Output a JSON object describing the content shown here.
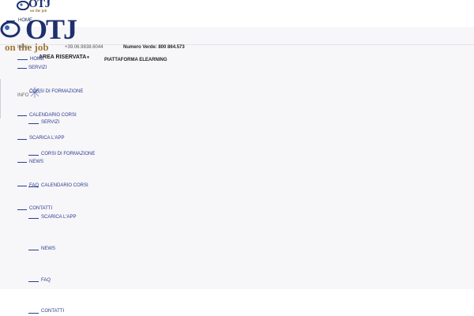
{
  "logo": {
    "mark": "OTJ",
    "registered": "®",
    "tagline": "on the job"
  },
  "top_nav": {
    "home": "HOME"
  },
  "contact": {
    "left_text": "Inizio",
    "phone": "+39.06.9838.6044",
    "toll_free": "Numero Verde: 800 864.573"
  },
  "header_links": {
    "reserved_area": "AREA RISERVATA",
    "reserved_area_chevron": "chevron-down-icon",
    "elearning": "PIATTAFORMA ELEARNING"
  },
  "menu_primary": [
    "HOME",
    "SERVIZI",
    "CORSI DI FORMAZIONE",
    "CALENDARIO CORSI",
    "SCARICA L'APP",
    "NEWS",
    "FAQ",
    "CONTATTI"
  ],
  "menu_secondary": [
    "SERVIZI",
    "CORSI DI FORMAZIONE",
    "CALENDARIO CORSI",
    "SCARICA L'APP",
    "NEWS",
    "FAQ",
    "CONTATTI"
  ],
  "info_label": "INFO",
  "icons": {
    "logo_mark": "globe-o-icon",
    "sparkle": "sparkle-icon"
  },
  "colors": {
    "brand_blue": "#1e2f6e",
    "brand_gold": "#a07a3a",
    "link_blue": "#2c3e90",
    "panel_bg": "#f7f6f9"
  }
}
